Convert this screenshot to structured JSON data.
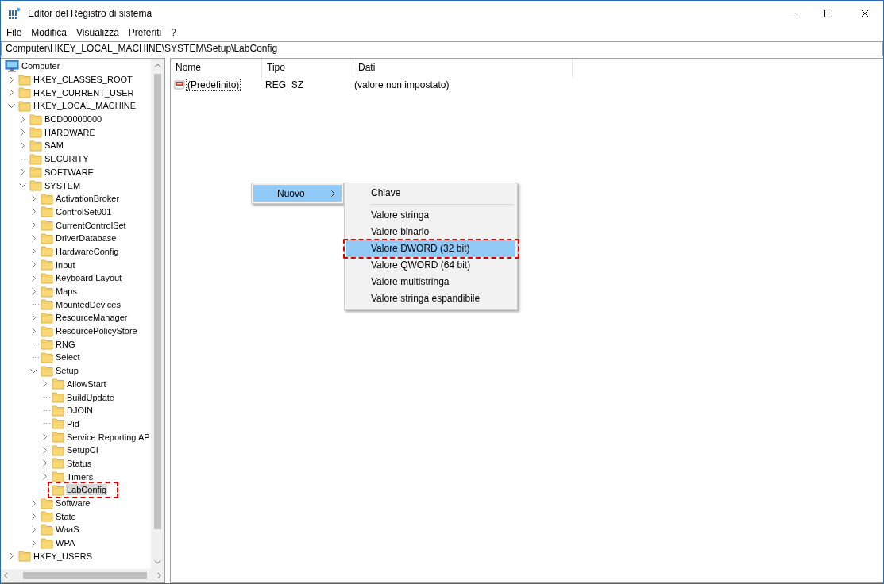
{
  "window": {
    "title": "Editor del Registro di sistema"
  },
  "menu_bar": [
    "File",
    "Modifica",
    "Visualizza",
    "Preferiti",
    "?"
  ],
  "address": "Computer\\HKEY_LOCAL_MACHINE\\SYSTEM\\Setup\\LabConfig",
  "tree": [
    {
      "label": "Computer",
      "kind": "computer",
      "selected": false,
      "children": [
        {
          "label": "HKEY_CLASSES_ROOT",
          "kind": "key",
          "has_children": true,
          "expanded": false,
          "selected": false,
          "annotated": false
        },
        {
          "label": "HKEY_CURRENT_USER",
          "kind": "key",
          "has_children": true,
          "expanded": false,
          "selected": false,
          "annotated": false
        },
        {
          "label": "HKEY_LOCAL_MACHINE",
          "kind": "key",
          "has_children": true,
          "expanded": true,
          "selected": false,
          "annotated": false,
          "children": [
            {
              "label": "BCD00000000",
              "kind": "key",
              "has_children": true,
              "expanded": false,
              "selected": false,
              "annotated": false
            },
            {
              "label": "HARDWARE",
              "kind": "key",
              "has_children": true,
              "expanded": false,
              "selected": false,
              "annotated": false
            },
            {
              "label": "SAM",
              "kind": "key",
              "has_children": true,
              "expanded": false,
              "selected": false,
              "annotated": false
            },
            {
              "label": "SECURITY",
              "kind": "key",
              "has_children": false,
              "selected": false,
              "annotated": false
            },
            {
              "label": "SOFTWARE",
              "kind": "key",
              "has_children": true,
              "expanded": false,
              "selected": false,
              "annotated": false
            },
            {
              "label": "SYSTEM",
              "kind": "key",
              "has_children": true,
              "expanded": true,
              "selected": false,
              "annotated": false,
              "children": [
                {
                  "label": "ActivationBroker",
                  "kind": "key",
                  "has_children": true,
                  "expanded": false,
                  "selected": false,
                  "annotated": false
                },
                {
                  "label": "ControlSet001",
                  "kind": "key",
                  "has_children": true,
                  "expanded": false,
                  "selected": false,
                  "annotated": false
                },
                {
                  "label": "CurrentControlSet",
                  "kind": "key",
                  "has_children": true,
                  "expanded": false,
                  "selected": false,
                  "annotated": false
                },
                {
                  "label": "DriverDatabase",
                  "kind": "key",
                  "has_children": true,
                  "expanded": false,
                  "selected": false,
                  "annotated": false
                },
                {
                  "label": "HardwareConfig",
                  "kind": "key",
                  "has_children": true,
                  "expanded": false,
                  "selected": false,
                  "annotated": false
                },
                {
                  "label": "Input",
                  "kind": "key",
                  "has_children": true,
                  "expanded": false,
                  "selected": false,
                  "annotated": false
                },
                {
                  "label": "Keyboard Layout",
                  "kind": "key",
                  "has_children": true,
                  "expanded": false,
                  "selected": false,
                  "annotated": false
                },
                {
                  "label": "Maps",
                  "kind": "key",
                  "has_children": true,
                  "expanded": false,
                  "selected": false,
                  "annotated": false
                },
                {
                  "label": "MountedDevices",
                  "kind": "key",
                  "has_children": false,
                  "selected": false,
                  "annotated": false
                },
                {
                  "label": "ResourceManager",
                  "kind": "key",
                  "has_children": true,
                  "expanded": false,
                  "selected": false,
                  "annotated": false
                },
                {
                  "label": "ResourcePolicyStore",
                  "kind": "key",
                  "has_children": true,
                  "expanded": false,
                  "selected": false,
                  "annotated": false
                },
                {
                  "label": "RNG",
                  "kind": "key",
                  "has_children": false,
                  "selected": false,
                  "annotated": false
                },
                {
                  "label": "Select",
                  "kind": "key",
                  "has_children": false,
                  "selected": false,
                  "annotated": false
                },
                {
                  "label": "Setup",
                  "kind": "key",
                  "has_children": true,
                  "expanded": true,
                  "selected": false,
                  "annotated": false,
                  "children": [
                    {
                      "label": "AllowStart",
                      "kind": "key",
                      "has_children": true,
                      "expanded": false,
                      "selected": false,
                      "annotated": false
                    },
                    {
                      "label": "BuildUpdate",
                      "kind": "key",
                      "has_children": false,
                      "selected": false,
                      "annotated": false
                    },
                    {
                      "label": "DJOIN",
                      "kind": "key",
                      "has_children": false,
                      "selected": false,
                      "annotated": false
                    },
                    {
                      "label": "Pid",
                      "kind": "key",
                      "has_children": false,
                      "selected": false,
                      "annotated": false
                    },
                    {
                      "label": "Service Reporting AP",
                      "kind": "key",
                      "has_children": true,
                      "expanded": false,
                      "selected": false,
                      "annotated": false
                    },
                    {
                      "label": "SetupCI",
                      "kind": "key",
                      "has_children": true,
                      "expanded": false,
                      "selected": false,
                      "annotated": false
                    },
                    {
                      "label": "Status",
                      "kind": "key",
                      "has_children": true,
                      "expanded": false,
                      "selected": false,
                      "annotated": false
                    },
                    {
                      "label": "Timers",
                      "kind": "key",
                      "has_children": true,
                      "expanded": false,
                      "selected": false,
                      "annotated": false
                    },
                    {
                      "label": "LabConfig",
                      "kind": "key",
                      "has_children": false,
                      "selected": true,
                      "annotated": true
                    }
                  ]
                },
                {
                  "label": "Software",
                  "kind": "key",
                  "has_children": true,
                  "expanded": false,
                  "selected": false,
                  "annotated": false
                },
                {
                  "label": "State",
                  "kind": "key",
                  "has_children": true,
                  "expanded": false,
                  "selected": false,
                  "annotated": false
                },
                {
                  "label": "WaaS",
                  "kind": "key",
                  "has_children": true,
                  "expanded": false,
                  "selected": false,
                  "annotated": false
                },
                {
                  "label": "WPA",
                  "kind": "key",
                  "has_children": true,
                  "expanded": false,
                  "selected": false,
                  "annotated": false
                }
              ]
            }
          ]
        },
        {
          "label": "HKEY_USERS",
          "kind": "key",
          "has_children": true,
          "expanded": false,
          "selected": false,
          "annotated": false
        }
      ]
    }
  ],
  "table": {
    "columns": [
      "Nome",
      "Tipo",
      "Dati"
    ],
    "rows": [
      {
        "name": "(Predefinito)",
        "type": "REG_SZ",
        "data": "(valore non impostato)",
        "kind": "string",
        "focused": true
      }
    ]
  },
  "context_menu": {
    "items": [
      {
        "label": "Nuovo",
        "has_submenu": true,
        "selected": true
      }
    ],
    "submenu": [
      {
        "kind": "item",
        "label": "Chiave",
        "selected": false,
        "annotated": false
      },
      {
        "kind": "separator"
      },
      {
        "kind": "item",
        "label": "Valore stringa",
        "selected": false,
        "annotated": false
      },
      {
        "kind": "item",
        "label": "Valore binario",
        "selected": false,
        "annotated": false
      },
      {
        "kind": "item",
        "label": "Valore DWORD (32 bit)",
        "selected": true,
        "annotated": true
      },
      {
        "kind": "item",
        "label": "Valore QWORD (64 bit)",
        "selected": false,
        "annotated": false
      },
      {
        "kind": "item",
        "label": "Valore multistringa",
        "selected": false,
        "annotated": false
      },
      {
        "kind": "item",
        "label": "Valore stringa espandibile",
        "selected": false,
        "annotated": false
      }
    ]
  }
}
